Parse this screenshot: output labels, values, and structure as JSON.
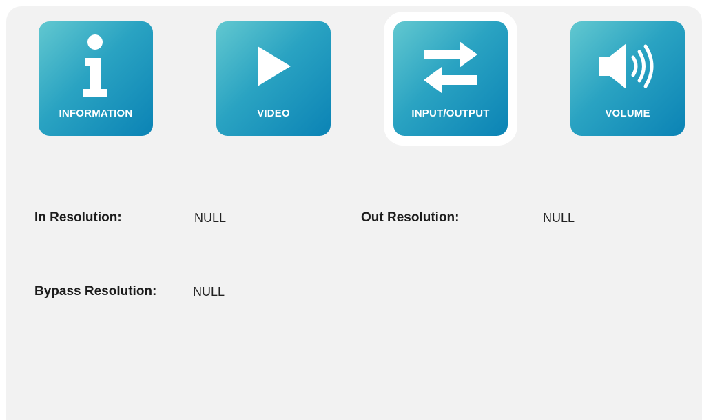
{
  "tabs": [
    {
      "label": "INFORMATION",
      "icon": "info-icon"
    },
    {
      "label": "VIDEO",
      "icon": "play-icon"
    },
    {
      "label": "INPUT/OUTPUT",
      "icon": "swap-arrows-icon",
      "selected": true
    },
    {
      "label": "VOLUME",
      "icon": "speaker-icon"
    }
  ],
  "fields": {
    "in_resolution": {
      "label": "In Resolution:",
      "value": "NULL"
    },
    "out_resolution": {
      "label": "Out Resolution:",
      "value": "NULL"
    },
    "bypass_resolution": {
      "label": "Bypass Resolution:",
      "value": "NULL"
    }
  },
  "colors": {
    "tile_gradient_start": "#62c8d0",
    "tile_gradient_end": "#0b83b5",
    "panel_background": "#f2f2f2",
    "selected_highlight": "#ffffff"
  }
}
